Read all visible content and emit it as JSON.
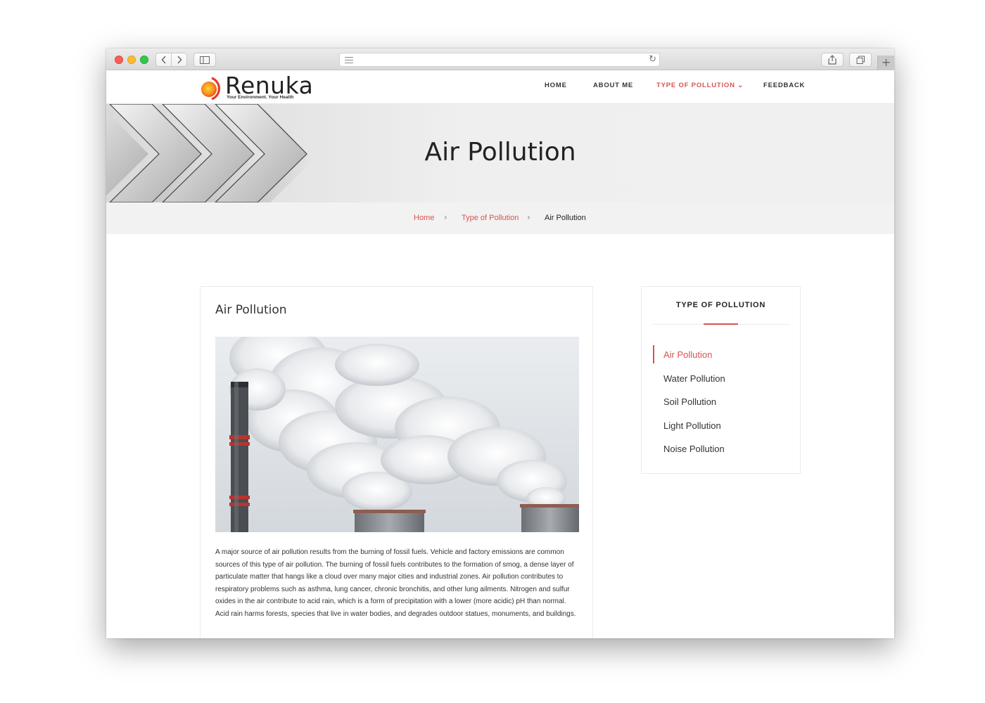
{
  "browser": {
    "reload_glyph": "↻",
    "plus_glyph": "+"
  },
  "site": {
    "logo": {
      "name": "Renuka",
      "tagline": "Your Environment. Your Health"
    },
    "nav": [
      {
        "label": "HOME"
      },
      {
        "label": "ABOUT ME"
      },
      {
        "label": "TYPE OF POLLUTION ⌄"
      },
      {
        "label": "FEEDBACK"
      }
    ],
    "accent_color": "#d9534f"
  },
  "banner": {
    "title": "Air Pollution"
  },
  "breadcrumb": {
    "items": [
      "Home",
      "Type of Pollution",
      "Air Pollution"
    ],
    "separator": "›"
  },
  "article": {
    "title": "Air Pollution",
    "image_icon": "factory-smoke-image",
    "body": "A major source of air pollution results from the burning of fossil fuels. Vehicle and factory emissions are common sources of this type of air pollution. The burning of fossil fuels contributes to the formation of smog, a dense layer of particulate matter that hangs like a cloud over many major cities and industrial zones. Air pollution contributes to respiratory problems such as asthma, lung cancer, chronic bronchitis, and other lung ailments. Nitrogen and sulfur oxides in the air contribute to acid rain, which is a form of precipitation with a lower (more acidic) pH than normal. Acid rain harms forests, species that live in water bodies, and degrades outdoor statues, monuments, and buildings."
  },
  "sidebar": {
    "title": "TYPE OF POLLUTION",
    "items": [
      "Air Pollution",
      "Water Pollution",
      "Soil Pollution",
      "Light Pollution",
      "Noise Pollution"
    ]
  }
}
